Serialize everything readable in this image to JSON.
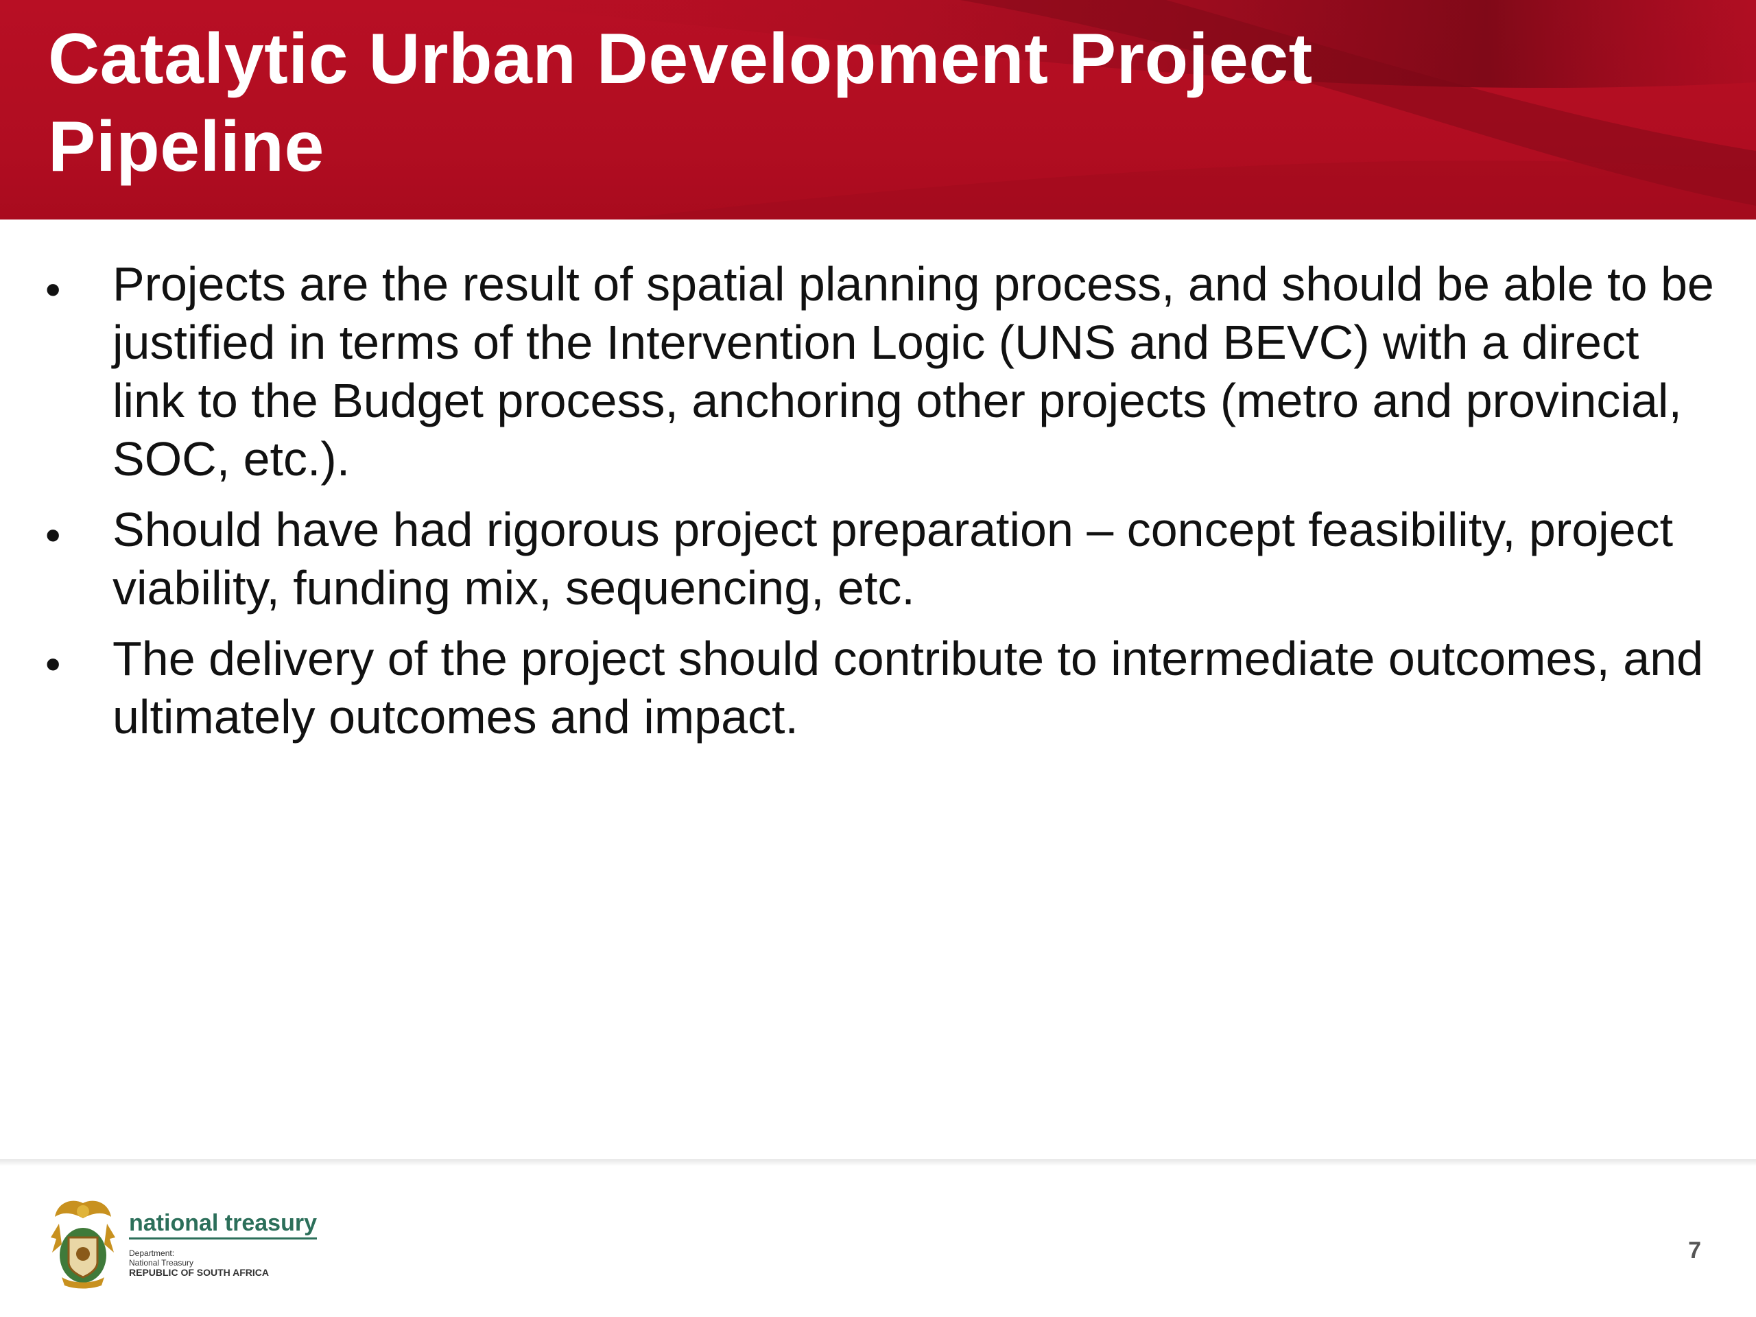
{
  "slide": {
    "title_line1": "Catalytic Urban Development Project",
    "title_line2": "Pipeline",
    "bullets": [
      {
        "text": "Projects are the result of spatial planning process, and should be able to be justified in terms of the Intervention Logic (UNS and BEVC) with a direct link to the Budget process, anchoring other projects (metro and provincial, SOC, etc.)."
      },
      {
        "text": "Should have had rigorous project preparation – concept feasibility, project viability, funding mix, sequencing, etc."
      },
      {
        "text": "The delivery of the project should contribute to intermediate outcomes, and ultimately outcomes and impact."
      }
    ],
    "bullet_symbol": "•",
    "page_number": "7"
  },
  "footer": {
    "logo_icon": "coat-of-arms-icon",
    "brand_name": "national treasury",
    "line1": "Department:",
    "line2": "National Treasury",
    "line3": "REPUBLIC OF SOUTH AFRICA"
  },
  "colors": {
    "header_red": "#b80f24",
    "header_dark": "#6e0714",
    "brand_green": "#2c6f5a"
  }
}
